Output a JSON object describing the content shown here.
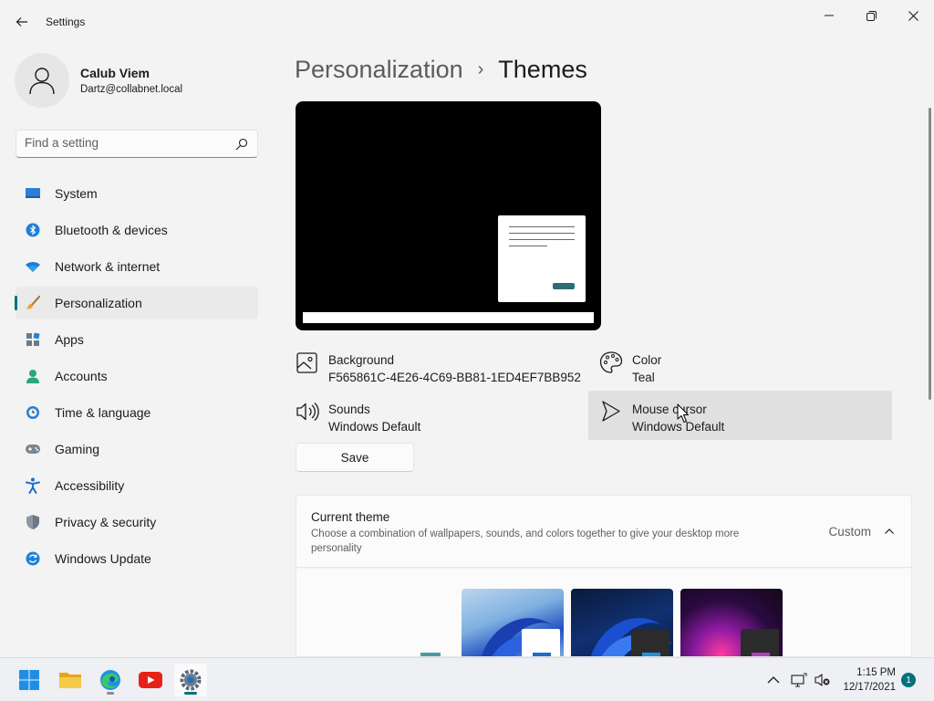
{
  "window": {
    "title": "Settings"
  },
  "user": {
    "name": "Calub Viem",
    "email": "Dartz@collabnet.local"
  },
  "search": {
    "placeholder": "Find a setting"
  },
  "sidebar": {
    "items": [
      {
        "label": "System",
        "icon": "system-icon"
      },
      {
        "label": "Bluetooth & devices",
        "icon": "bluetooth-icon"
      },
      {
        "label": "Network & internet",
        "icon": "wifi-icon"
      },
      {
        "label": "Personalization",
        "icon": "brush-icon",
        "selected": true
      },
      {
        "label": "Apps",
        "icon": "apps-icon"
      },
      {
        "label": "Accounts",
        "icon": "accounts-icon"
      },
      {
        "label": "Time & language",
        "icon": "clock-globe-icon"
      },
      {
        "label": "Gaming",
        "icon": "gamepad-icon"
      },
      {
        "label": "Accessibility",
        "icon": "accessibility-icon"
      },
      {
        "label": "Privacy & security",
        "icon": "shield-icon"
      },
      {
        "label": "Windows Update",
        "icon": "update-icon"
      }
    ]
  },
  "breadcrumb": {
    "parent": "Personalization",
    "separator": "›",
    "current": "Themes"
  },
  "theme_props": {
    "background": {
      "title": "Background",
      "value": "F565861C-4E26-4C69-BB81-1ED4EF7BB952"
    },
    "color": {
      "title": "Color",
      "value": "Teal"
    },
    "sounds": {
      "title": "Sounds",
      "value": "Windows Default"
    },
    "mouse_cursor": {
      "title": "Mouse cursor",
      "value": "Windows Default"
    }
  },
  "save_label": "Save",
  "current_theme": {
    "title": "Current theme",
    "description": "Choose a combination of wallpapers, sounds, and colors together to give your desktop more personality",
    "value": "Custom"
  },
  "taskbar": {
    "apps": [
      "start-icon",
      "file-explorer-icon",
      "edge-icon",
      "youtube-icon",
      "settings-icon"
    ],
    "time": "1:15 PM",
    "date": "12/17/2021",
    "notification_count": "1"
  },
  "colors": {
    "accent": "#00717c",
    "preview_button": "#2b6e76"
  }
}
